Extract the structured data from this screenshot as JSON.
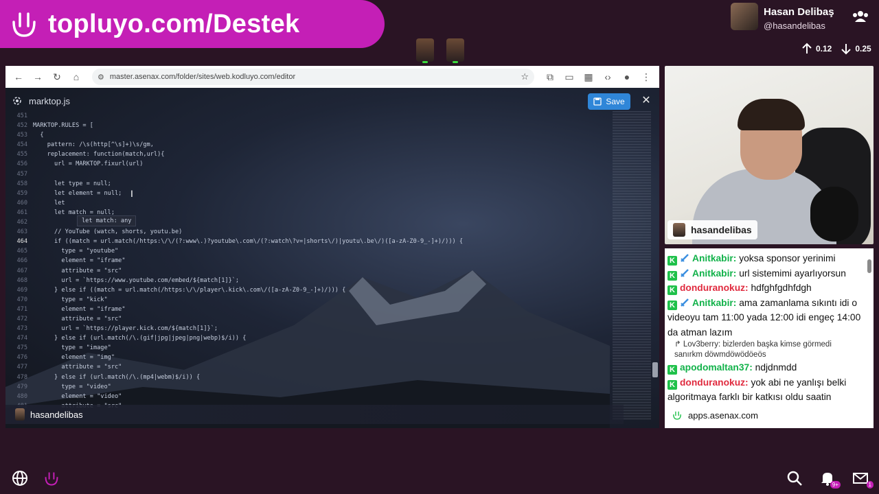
{
  "banner": {
    "text": "topluyo.com/Destek"
  },
  "profile": {
    "name": "Hasan Delibaş",
    "handle": "@hasandelibas"
  },
  "stats": {
    "up": "0.12",
    "down": "0.25"
  },
  "browser": {
    "url": "master.asenax.com/folder/sites/web.kodluyo.com/editor"
  },
  "editor": {
    "file_name": "marktop.js",
    "save_label": "Save",
    "tooltip": "let match: any",
    "lines": [
      {
        "n": "451",
        "t": ""
      },
      {
        "n": "452",
        "t": "MARKTOP.RULES = ["
      },
      {
        "n": "453",
        "t": "  {"
      },
      {
        "n": "454",
        "t": "    pattern: /\\s(http[^\\s]+)\\s/gm,"
      },
      {
        "n": "455",
        "t": "    replacement: function(match,url){"
      },
      {
        "n": "456",
        "t": "      url = MARKTOP.fixurl(url)"
      },
      {
        "n": "457",
        "t": ""
      },
      {
        "n": "458",
        "t": "      let type = null;"
      },
      {
        "n": "459",
        "t": "      let element = null;"
      },
      {
        "n": "460",
        "t": "      let"
      },
      {
        "n": "461",
        "t": "      let match = null;"
      },
      {
        "n": "462",
        "t": ""
      },
      {
        "n": "463",
        "t": "      // YouTube (watch, shorts, youtu.be)"
      },
      {
        "n": "464",
        "t": "      if ((match = url.match(/https:\\/\\/(?:www\\.)?youtube\\.com\\/(?:watch\\?v=|shorts\\/)|youtu\\.be\\/)([a-zA-Z0-9_-]+)/))) {"
      },
      {
        "n": "465",
        "t": "        type = \"youtube\""
      },
      {
        "n": "466",
        "t": "        element = \"iframe\""
      },
      {
        "n": "467",
        "t": "        attribute = \"src\""
      },
      {
        "n": "468",
        "t": "        url = `https://www.youtube.com/embed/${match[1]}`;"
      },
      {
        "n": "469",
        "t": "      } else if ((match = url.match(/https:\\/\\/player\\.kick\\.com\\/([a-zA-Z0-9_-]+)/))) {"
      },
      {
        "n": "470",
        "t": "        type = \"kick\""
      },
      {
        "n": "471",
        "t": "        element = \"iframe\""
      },
      {
        "n": "472",
        "t": "        attribute = \"src\""
      },
      {
        "n": "473",
        "t": "        url = `https://player.kick.com/${match[1]}`;"
      },
      {
        "n": "474",
        "t": "      } else if (url.match(/\\.(gif|jpg|jpeg|png|webp)$/i)) {"
      },
      {
        "n": "475",
        "t": "        type = \"image\""
      },
      {
        "n": "476",
        "t": "        element = \"img\""
      },
      {
        "n": "477",
        "t": "        attribute = \"src\""
      },
      {
        "n": "478",
        "t": "      } else if (url.match(/\\.(mp4|webm)$/i)) {"
      },
      {
        "n": "479",
        "t": "        type = \"video\""
      },
      {
        "n": "480",
        "t": "        element = \"video\""
      },
      {
        "n": "481",
        "t": "        attribute = \"src\""
      }
    ],
    "active_line": "464"
  },
  "stream_overlay_user": "hasandelibas",
  "webcam": {
    "tag": "hasandelibas"
  },
  "chat": {
    "messages": [
      {
        "badges": [
          "k",
          "sword"
        ],
        "user": "Anitkabir",
        "color": "green",
        "text": "yoksa sponsor yerinimi"
      },
      {
        "badges": [
          "k",
          "sword"
        ],
        "user": "Anitkabir",
        "color": "green",
        "text": "url sistemimi ayarlıyorsun"
      },
      {
        "badges": [
          "k"
        ],
        "user": "donduranokuz",
        "color": "red",
        "text": "hdfghfgdhfdgh"
      },
      {
        "badges": [
          "k",
          "sword"
        ],
        "user": "Anitkabir",
        "color": "green",
        "text": "ama zamanlama sıkıntı idi o videoyu tam 11:00 yada 12:00 idi engeç 14:00 da atman lazım"
      },
      {
        "reply": "↱ Lov3berry: bizlerden başka kimse görmedi sanırkm döwmdöwödöeös"
      },
      {
        "badges": [
          "k"
        ],
        "user": "apodomaltan37",
        "color": "green",
        "text": "ndjdnmdd"
      },
      {
        "badges": [
          "k"
        ],
        "user": "donduranokuz",
        "color": "red",
        "text": "yok abi ne yanlışı belki algoritmaya farklı bir katkısı oldu saatin"
      }
    ],
    "overlay_label": "apps.asenax.com",
    "overlay_tail": "zlerden başka kimse görmedi sanırkm döwmdöwödöeös"
  },
  "bottom": {
    "notif_count": "9+",
    "mail_count": "1"
  },
  "colors": {
    "brand": "#c41fb6",
    "save": "#2f86d8",
    "green_user": "#12b24a",
    "red_user": "#e02a3e"
  }
}
